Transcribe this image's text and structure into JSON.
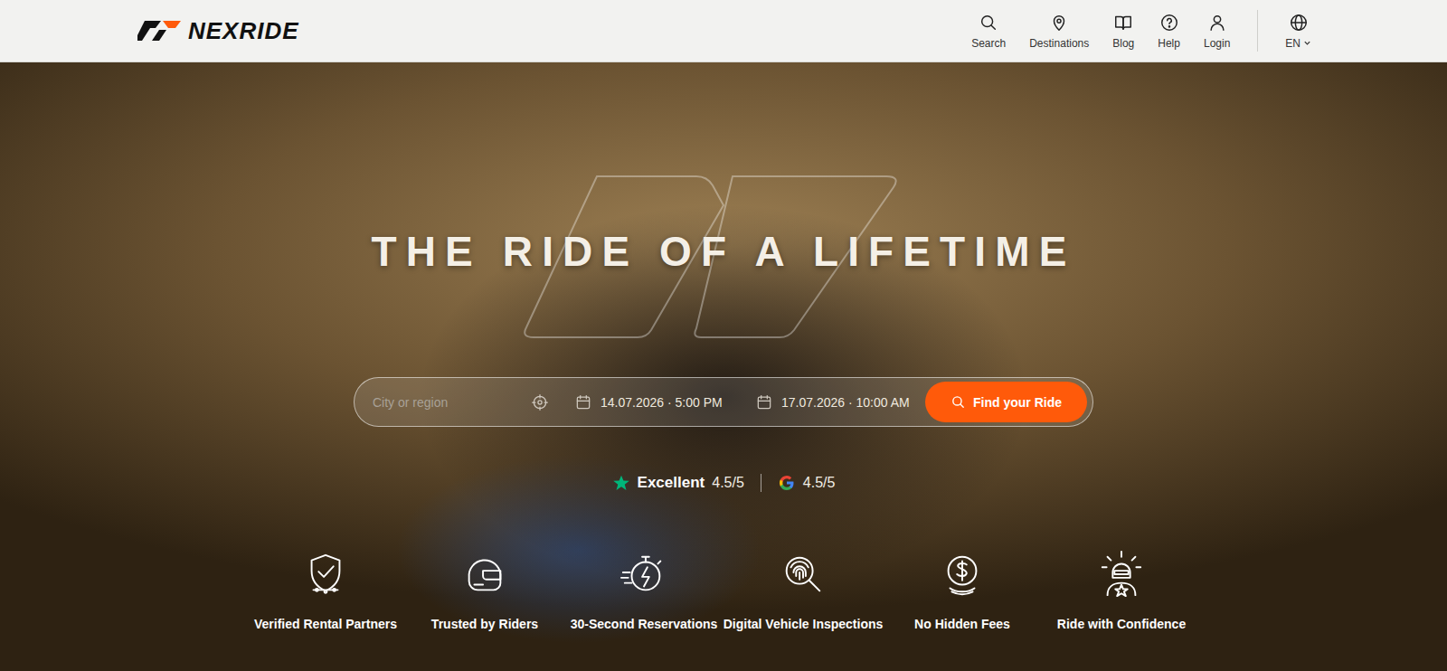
{
  "header": {
    "logo": "NEXRIDE",
    "nav": [
      {
        "label": "Search"
      },
      {
        "label": "Destinations"
      },
      {
        "label": "Blog"
      },
      {
        "label": "Help"
      },
      {
        "label": "Login"
      }
    ],
    "language": "EN"
  },
  "hero": {
    "title": "THE RIDE OF A LIFETIME"
  },
  "search_bar": {
    "placeholder": "City or region",
    "pickup": "14.07.2026 · 5:00 PM",
    "return": "17.07.2026 · 10:00 AM",
    "button": "Find your Ride"
  },
  "ratings": {
    "trustpilot": {
      "label": "Excellent",
      "score": "4.5/5"
    },
    "google": {
      "score": "4.5/5"
    }
  },
  "features": [
    {
      "label": "Verified Rental Partners"
    },
    {
      "label": "Trusted by Riders"
    },
    {
      "label": "30-Second Reservations"
    },
    {
      "label": "Digital Vehicle Inspections"
    },
    {
      "label": "No Hidden Fees"
    },
    {
      "label": "Ride with Confidence"
    }
  ]
}
